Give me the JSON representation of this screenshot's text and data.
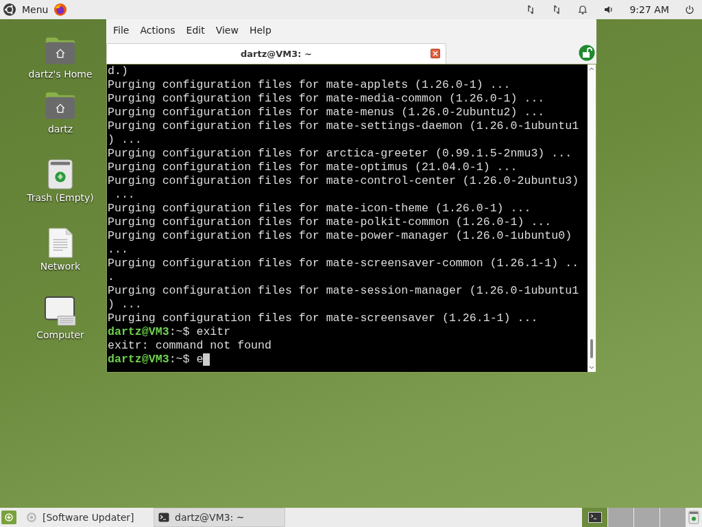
{
  "top_panel": {
    "menu_label": "Menu",
    "clock": "9:27 AM"
  },
  "desktop_icons": [
    {
      "label": "dartz's Home",
      "kind": "home"
    },
    {
      "label": "dartz",
      "kind": "home"
    },
    {
      "label": "Trash (Empty)",
      "kind": "trash"
    },
    {
      "label": "Network",
      "kind": "document"
    },
    {
      "label": "Computer",
      "kind": "computer"
    }
  ],
  "terminal": {
    "menu": [
      "File",
      "Actions",
      "Edit",
      "View",
      "Help"
    ],
    "tabs": [
      {
        "title": "dartz@VM3: ~",
        "selected": true
      }
    ],
    "lines": [
      {
        "kind": "output",
        "text": "d.)"
      },
      {
        "kind": "output",
        "text": "Purging configuration files for mate-applets (1.26.0-1) ..."
      },
      {
        "kind": "output",
        "text": "Purging configuration files for mate-media-common (1.26.0-1) ..."
      },
      {
        "kind": "output",
        "text": "Purging configuration files for mate-menus (1.26.0-2ubuntu2) ..."
      },
      {
        "kind": "output",
        "text": "Purging configuration files for mate-settings-daemon (1.26.0-1ubuntu1"
      },
      {
        "kind": "output",
        "text": ") ..."
      },
      {
        "kind": "output",
        "text": "Purging configuration files for arctica-greeter (0.99.1.5-2nmu3) ..."
      },
      {
        "kind": "output",
        "text": "Purging configuration files for mate-optimus (21.04.0-1) ..."
      },
      {
        "kind": "output",
        "text": "Purging configuration files for mate-control-center (1.26.0-2ubuntu3)"
      },
      {
        "kind": "output",
        "text": " ..."
      },
      {
        "kind": "output",
        "text": "Purging configuration files for mate-icon-theme (1.26.0-1) ..."
      },
      {
        "kind": "output",
        "text": "Purging configuration files for mate-polkit-common (1.26.0-1) ..."
      },
      {
        "kind": "output",
        "text": "Purging configuration files for mate-power-manager (1.26.0-1ubuntu0)"
      },
      {
        "kind": "output",
        "text": "..."
      },
      {
        "kind": "output",
        "text": "Purging configuration files for mate-screensaver-common (1.26.1-1) .."
      },
      {
        "kind": "output",
        "text": "."
      },
      {
        "kind": "output",
        "text": "Purging configuration files for mate-session-manager (1.26.0-1ubuntu1"
      },
      {
        "kind": "output",
        "text": ") ..."
      },
      {
        "kind": "output",
        "text": "Purging configuration files for mate-screensaver (1.26.1-1) ..."
      },
      {
        "kind": "prompt",
        "prompt": "dartz@VM3",
        "command": ":~$ exitr",
        "cursor": false
      },
      {
        "kind": "output",
        "text": "exitr: command not found"
      },
      {
        "kind": "prompt",
        "prompt": "dartz@VM3",
        "command": ":~$ e",
        "cursor": true
      }
    ]
  },
  "taskbar": {
    "tasks": [
      {
        "label": "[Software Updater]",
        "kind": "updater",
        "selected": false
      },
      {
        "label": "dartz@VM3: ~",
        "kind": "terminal",
        "selected": true
      }
    ],
    "workspaces": [
      {
        "selected": true
      },
      {
        "selected": false
      },
      {
        "selected": false
      },
      {
        "selected": false
      }
    ]
  }
}
